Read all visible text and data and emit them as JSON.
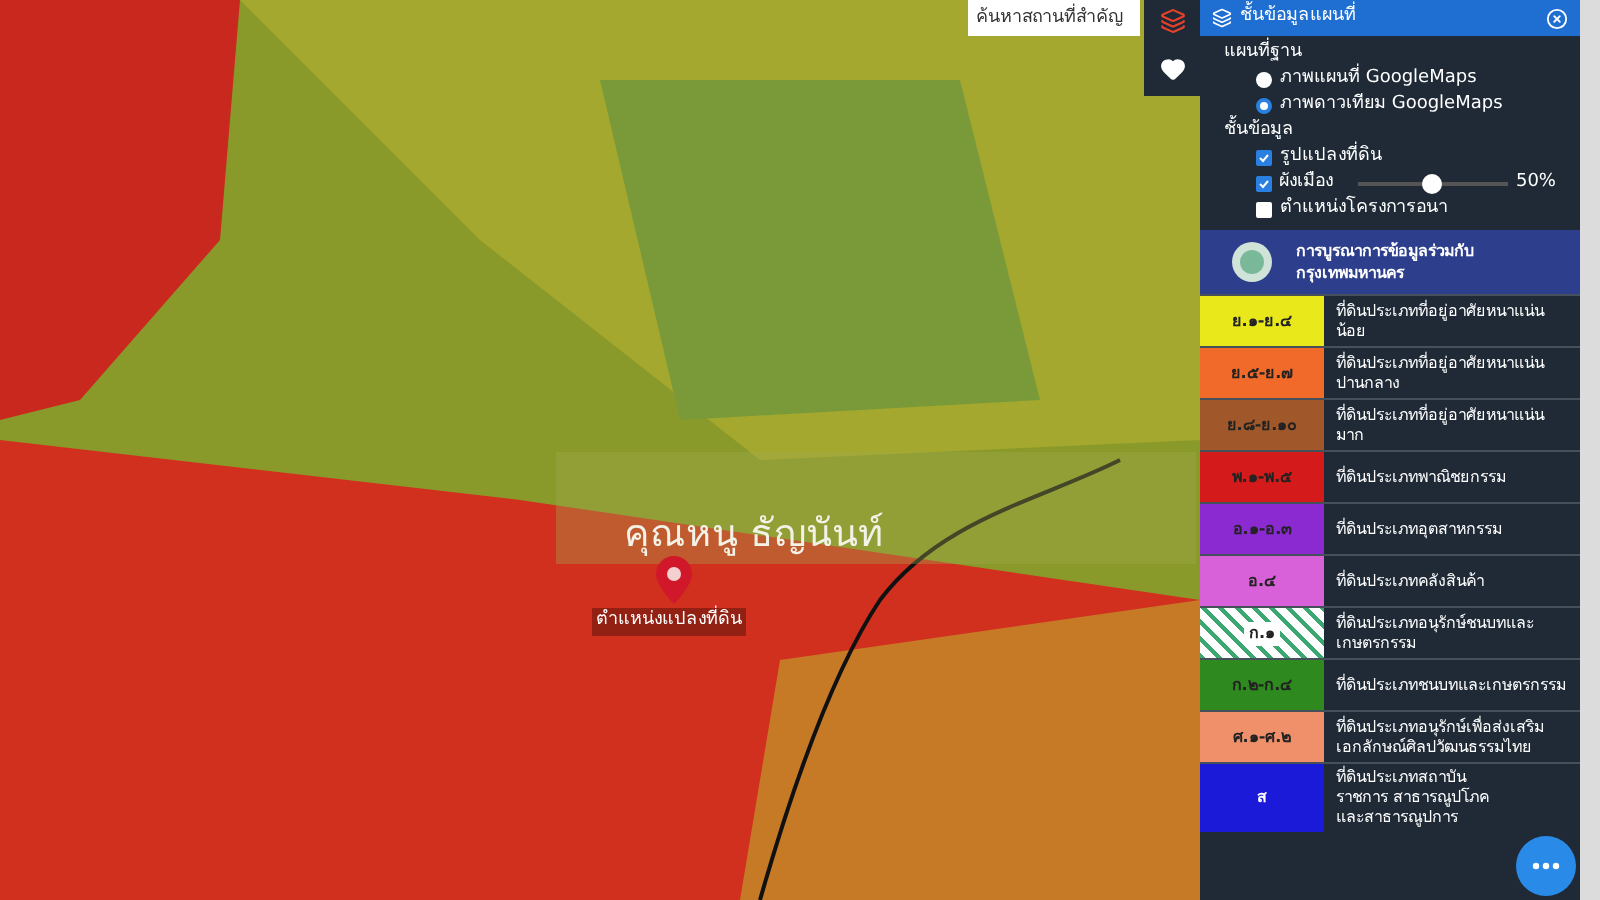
{
  "map": {
    "search": {
      "placeholder": "ค้นหาสถานที่สำคัญ"
    },
    "place_label": "คุณหนู ธัญนันท์",
    "pin_caption": "ตำแหน่งแปลงที่ดิน"
  },
  "panel": {
    "title": "ชั้นข้อมูลแผนที่",
    "basemap": {
      "heading": "แผนที่ฐาน",
      "options": [
        {
          "label": "ภาพแผนที่ GoogleMaps",
          "selected": false
        },
        {
          "label": "ภาพดาวเทียม GoogleMaps",
          "selected": true
        }
      ]
    },
    "layers": {
      "heading": "ชั้นข้อมูล",
      "items": [
        {
          "kind": "check",
          "label": "รูปแปลงที่ดิน",
          "checked": true
        },
        {
          "kind": "slider",
          "label": "ผังเมือง",
          "checked": true,
          "level": 0.5,
          "reading": "50%"
        },
        {
          "kind": "check",
          "label": "ตำแหน่งโครงการอนา",
          "checked": false
        }
      ]
    },
    "source": "การบูรณาการข้อมูลร่วมกับ กรุงเทพมหานคร",
    "legend": [
      {
        "code": "ย.๑-ย.๔",
        "text": "ที่ดินประเภทที่อยู่อาศัยหนาแน่นน้อย",
        "color": "#e8e81a",
        "kind": "solid"
      },
      {
        "code": "ย.๕-ย.๗",
        "text": "ที่ดินประเภทที่อยู่อาศัยหนาแน่นปานกลาง",
        "color": "#f26a2a",
        "kind": "solid"
      },
      {
        "code": "ย.๘-ย.๑๐",
        "text": "ที่ดินประเภทที่อยู่อาศัยหนาแน่นมาก",
        "color": "#a0582a",
        "kind": "solid"
      },
      {
        "code": "พ.๑-พ.๕",
        "text": "ที่ดินประเภทพาณิชยกรรม",
        "color": "#d41a1a",
        "kind": "solid"
      },
      {
        "code": "อ.๑-อ.๓",
        "text": "ที่ดินประเภทอุตสาหกรรม",
        "color": "#8a2ad0",
        "kind": "solid"
      },
      {
        "code": "อ.๔",
        "text": "ที่ดินประเภทคลังสินค้า",
        "color": "#d860d8",
        "kind": "solid"
      },
      {
        "code": "ก.๑",
        "text": "ที่ดินประเภทอนุรักษ์ชนบทและเกษตรกรรม",
        "color": "#3aa870",
        "kind": "hatched"
      },
      {
        "code": "ก.๒-ก.๔",
        "text": "ที่ดินประเภทชนบทและเกษตรกรรม",
        "color": "#2e8a1e",
        "kind": "solid"
      },
      {
        "code": "ศ.๑-ศ.๒",
        "text": "ที่ดินประเภทอนุรักษ์เพื่อส่งเสริมเอกลักษณ์ศิลปวัฒนธรรมไทย",
        "color": "#f0906a",
        "kind": "solid"
      },
      {
        "code": "ส",
        "text": "ที่ดินประเภทสถาบันราชการ สาธารณูปโภคและสาธารณูปการ",
        "color": "#1a1ad8",
        "kind": "solid"
      }
    ]
  }
}
